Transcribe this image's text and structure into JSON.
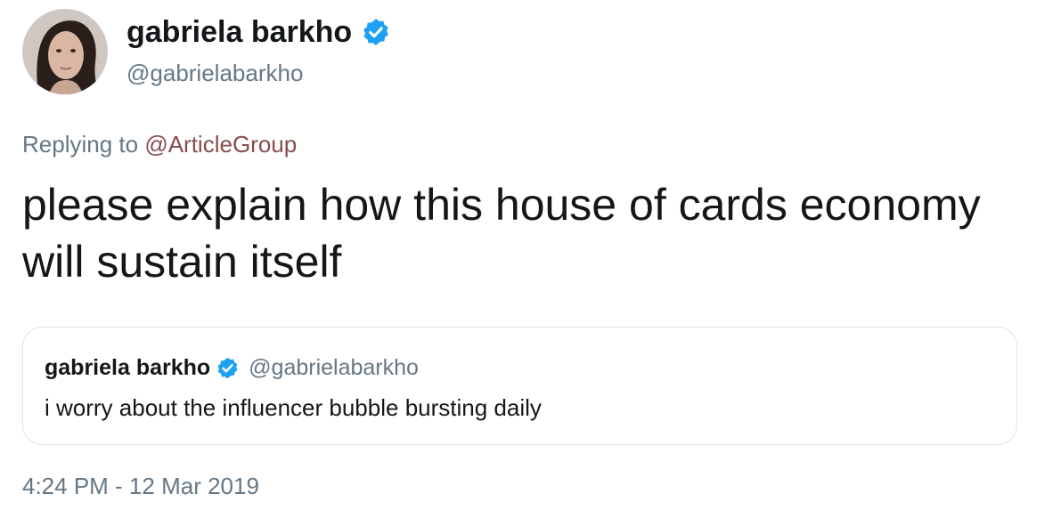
{
  "tweet": {
    "author": {
      "name": "gabriela barkho",
      "handle": "@gabrielabarkho",
      "verified": true
    },
    "replying_prefix": "Replying to ",
    "replying_to": "@ArticleGroup",
    "text": "please explain how this house of cards economy will sustain itself",
    "timestamp": "4:24 PM - 12 Mar 2019"
  },
  "quoted_tweet": {
    "author": {
      "name": "gabriela barkho",
      "handle": "@gabrielabarkho",
      "verified": true
    },
    "text": "i worry about the influencer bubble bursting daily"
  },
  "colors": {
    "text_primary": "#14171a",
    "text_secondary": "#657786",
    "verified_badge": "#1da1f2",
    "mention": "#8a4b4b",
    "card_border": "#dfe4e8"
  },
  "icons": {
    "verified": "verified-badge-icon"
  }
}
